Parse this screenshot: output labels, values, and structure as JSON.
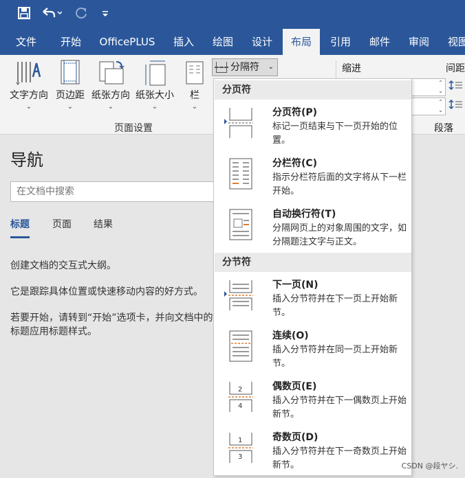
{
  "quick_access": {
    "save_icon": "save-icon",
    "undo_icon": "undo-icon",
    "redo_icon": "redo-icon",
    "customize_icon": "customize-icon"
  },
  "tabs": [
    {
      "label": "文件"
    },
    {
      "label": "开始"
    },
    {
      "label": "OfficePLUS"
    },
    {
      "label": "插入"
    },
    {
      "label": "绘图"
    },
    {
      "label": "设计"
    },
    {
      "label": "布局"
    },
    {
      "label": "引用"
    },
    {
      "label": "邮件"
    },
    {
      "label": "审阅"
    },
    {
      "label": "视图"
    }
  ],
  "active_tab": "布局",
  "ribbon": {
    "text_direction": "文字方向",
    "margins": "页边距",
    "orientation": "纸张方向",
    "size": "纸张大小",
    "columns": "栏",
    "page_setup_label": "页面设置",
    "breaks_button": "分隔符",
    "indent_label": "缩进",
    "spacing_label": "间距",
    "paragraph_label": "段落"
  },
  "nav": {
    "title": "导航",
    "search_placeholder": "在文档中搜索",
    "tabs": [
      "标题",
      "页面",
      "结果"
    ],
    "text1": "创建文档的交互式大纲。",
    "text2": "它是跟踪具体位置或快速移动内容的好方式。",
    "text3": "若要开始，请转到“开始”选项卡，并向文档中的标题应用标题样式。"
  },
  "menu": {
    "section1": "分页符",
    "section2": "分节符",
    "items": [
      {
        "title": "分页符(P)",
        "desc": "标记一页结束与下一页开始的位置。"
      },
      {
        "title": "分栏符(C)",
        "desc": "指示分栏符后面的文字将从下一栏开始。"
      },
      {
        "title": "自动换行符(T)",
        "desc": "分隔网页上的对象周围的文字，如分隔题注文字与正文。"
      },
      {
        "title": "下一页(N)",
        "desc": "插入分节符并在下一页上开始新节。"
      },
      {
        "title": "连续(O)",
        "desc": "插入分节符并在同一页上开始新节。"
      },
      {
        "title": "偶数页(E)",
        "desc": "插入分节符并在下一偶数页上开始新节。"
      },
      {
        "title": "奇数页(D)",
        "desc": "插入分节符并在下一奇数页上开始新节。"
      }
    ],
    "even_icon_nums": [
      "2",
      "4"
    ],
    "odd_icon_nums": [
      "1",
      "3"
    ]
  },
  "watermark": "CSDN @段ヤシ.",
  "colors": {
    "accent": "#2b579a",
    "highlight": "#e07c2d"
  }
}
